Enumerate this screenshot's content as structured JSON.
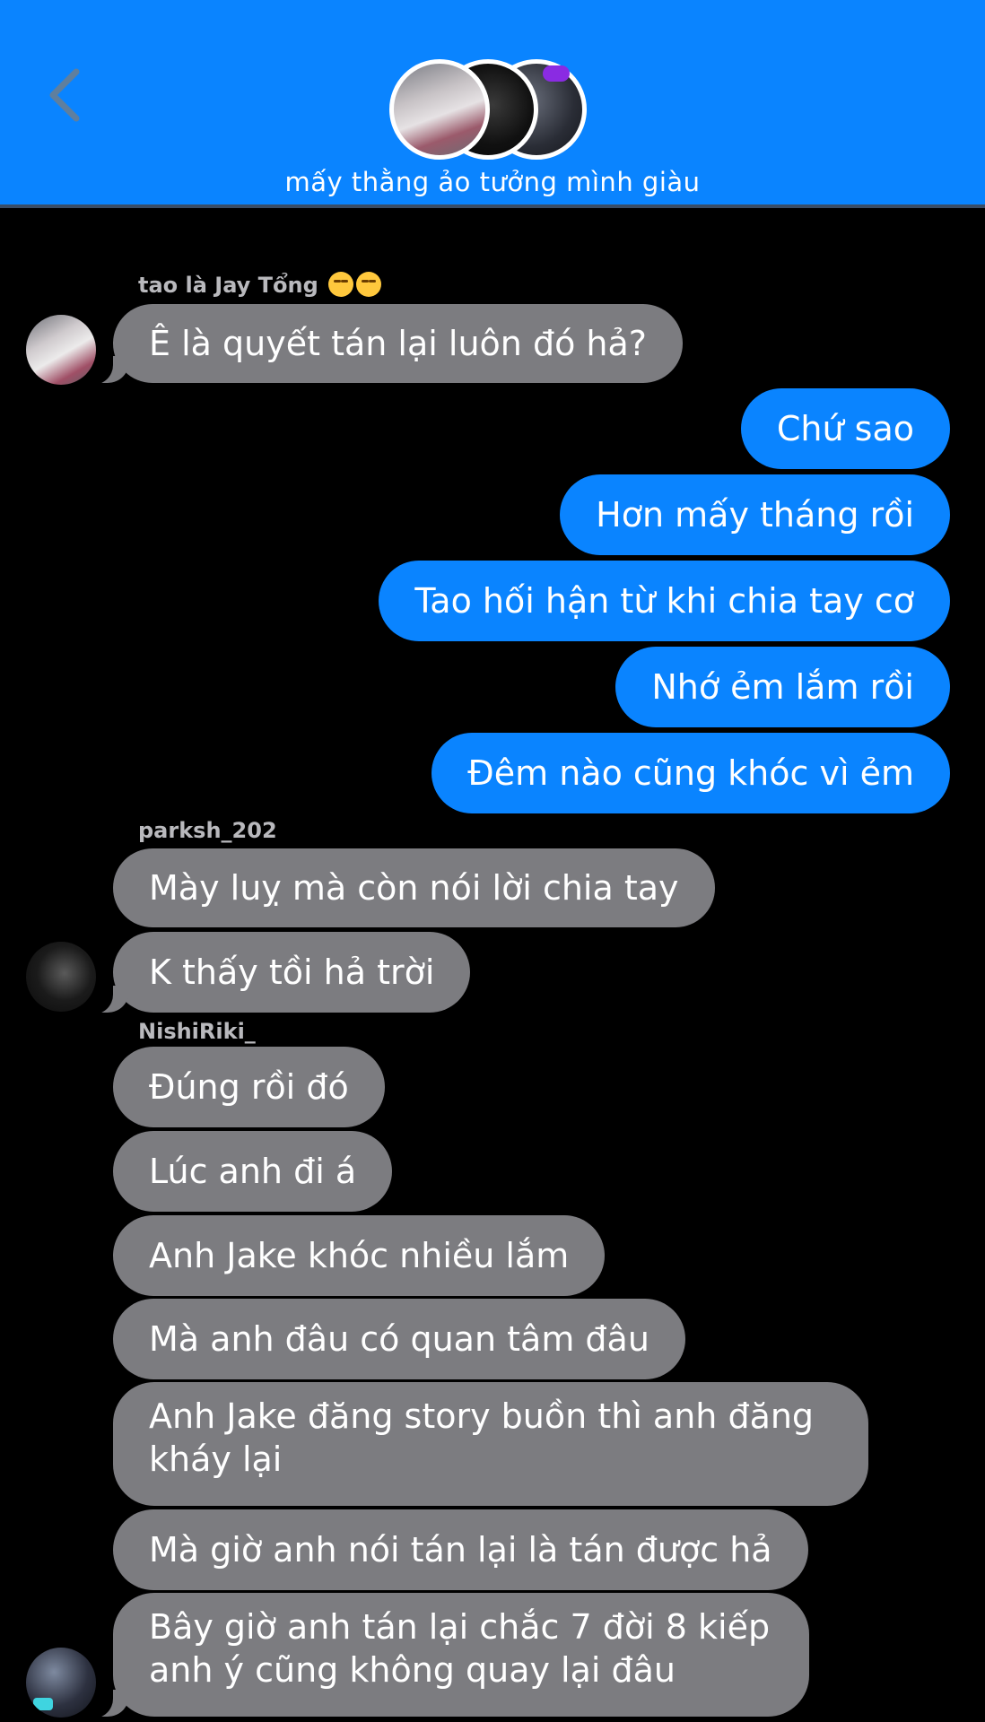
{
  "header": {
    "back_icon": "chevron-left-icon",
    "group_name": "mấy thằng ảo tưởng mình giàu",
    "accent_color": "#0a84ff"
  },
  "messages": {
    "jay_sender": "tao là Jay Tổng",
    "jay_1": "Ê là quyết tán lại luôn đó hả?",
    "me_1": "Chứ sao",
    "me_2": "Hơn mấy tháng rồi",
    "me_3": "Tao hối hận từ khi chia tay cơ",
    "me_4": "Nhớ ẻm lắm rồi",
    "me_5": "Đêm nào cũng khóc vì ẻm",
    "park_sender": "parksh_202",
    "park_1": "Mày luỵ mà còn nói lời chia tay",
    "park_2": "K thấy tồi hả trời",
    "nishi_sender": "NishiRiki_",
    "nishi_1": "Đúng rồi đó",
    "nishi_2": "Lúc anh đi á",
    "nishi_3": "Anh Jake khóc nhiều lắm",
    "nishi_4": "Mà anh đâu có quan tâm đâu",
    "nishi_5": "Anh Jake đăng story buồn thì anh đăng kháy lại",
    "nishi_6": "Mà giờ anh nói tán lại là tán được hả",
    "nishi_7": "Bây giờ anh tán lại chắc 7 đời 8 kiếp anh ý cũng không quay lại đâu"
  },
  "colors": {
    "incoming_bubble": "#7c7c80",
    "outgoing_bubble": "#0a84ff",
    "background": "#000000"
  }
}
